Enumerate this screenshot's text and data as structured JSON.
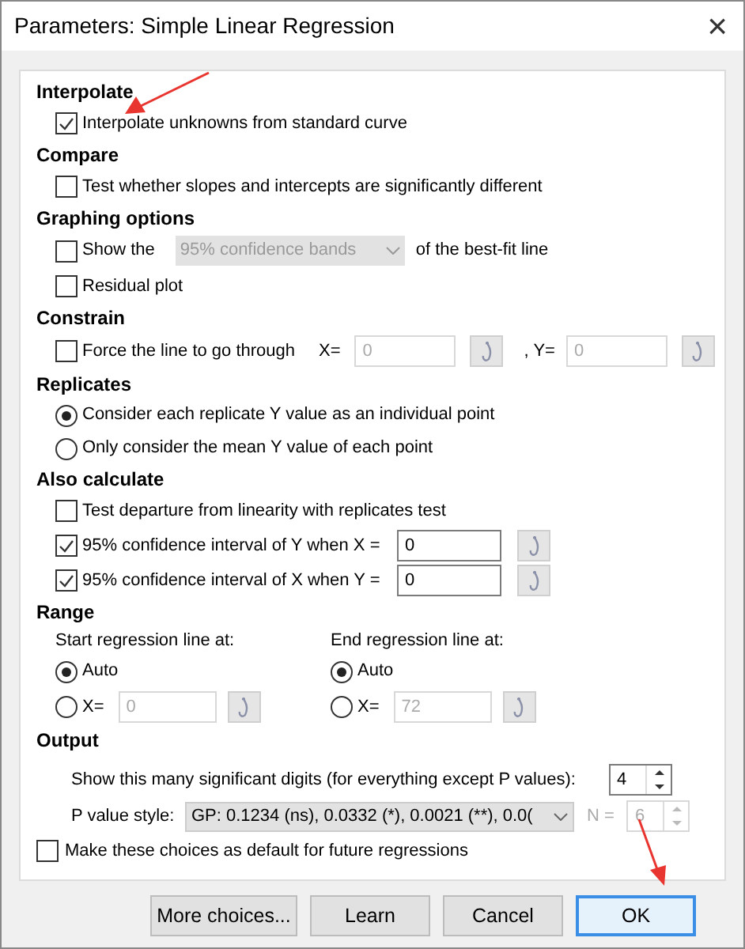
{
  "window": {
    "title": "Parameters: Simple Linear Regression",
    "close": "×"
  },
  "sections": [
    {
      "heading": "Interpolate",
      "rows": [
        {
          "kind": "checkbox",
          "label": "Interpolate unknowns from standard curve",
          "checked": true
        }
      ]
    },
    {
      "heading": "Compare",
      "rows": [
        {
          "kind": "checkbox",
          "label": "Test whether slopes and intercepts are significantly different",
          "checked": false
        }
      ]
    },
    {
      "heading": "Graphing options",
      "rows": [
        {
          "kind": "checkbox_select",
          "label": "Show the",
          "checked": false,
          "select": "95% confidence bands",
          "disabled": true,
          "suffix": "of the best-fit line"
        },
        {
          "kind": "checkbox",
          "label": "Residual plot",
          "checked": false
        }
      ]
    },
    {
      "heading": "Constrain",
      "rows": [
        {
          "kind": "checkbox_xy",
          "label": "Force the line to go through",
          "checked": false,
          "x_label": "X=",
          "x_value": "0",
          "y_label": ", Y=",
          "y_value": "0",
          "disabled": true
        }
      ]
    },
    {
      "heading": "Replicates",
      "rows": [
        {
          "kind": "radio",
          "label": "Consider each replicate Y value as an individual point",
          "selected": true
        },
        {
          "kind": "radio",
          "label": "Only consider the mean Y value of each point",
          "selected": false
        }
      ]
    },
    {
      "heading": "Also calculate",
      "rows": [
        {
          "kind": "checkbox",
          "label": "Test departure from linearity with replicates test",
          "checked": false
        },
        {
          "kind": "checkbox_field",
          "label": "95% confidence interval of Y when X =",
          "checked": true,
          "value": "0"
        },
        {
          "kind": "checkbox_field",
          "label": "95% confidence interval of X when Y =",
          "checked": true,
          "value": "0"
        }
      ]
    }
  ],
  "range": {
    "heading": "Range",
    "columns": [
      {
        "label": "Start regression line at:",
        "auto": {
          "label": "Auto",
          "selected": true
        },
        "x": {
          "label": "X=",
          "value": "0",
          "selected": false
        }
      },
      {
        "label": "End regression line at:",
        "auto": {
          "label": "Auto",
          "selected": true
        },
        "x": {
          "label": "X=",
          "value": "72",
          "selected": false
        }
      }
    ]
  },
  "output": {
    "heading": "Output",
    "digits_label": "Show this many significant digits (for everything except P values):",
    "digits_value": "4",
    "p_label": "P value style:",
    "p_value": "GP: 0.1234 (ns), 0.0332 (*), 0.0021 (**), 0.0(",
    "n_label": "N =",
    "n_value": "6",
    "n_disabled": true
  },
  "default_checkbox": {
    "label": "Make these choices as default for future regressions",
    "checked": false
  },
  "buttons": [
    {
      "label": "More choices...",
      "selected": false
    },
    {
      "label": "Learn",
      "selected": false
    },
    {
      "label": "Cancel",
      "selected": false
    },
    {
      "label": "OK",
      "selected": true
    }
  ]
}
